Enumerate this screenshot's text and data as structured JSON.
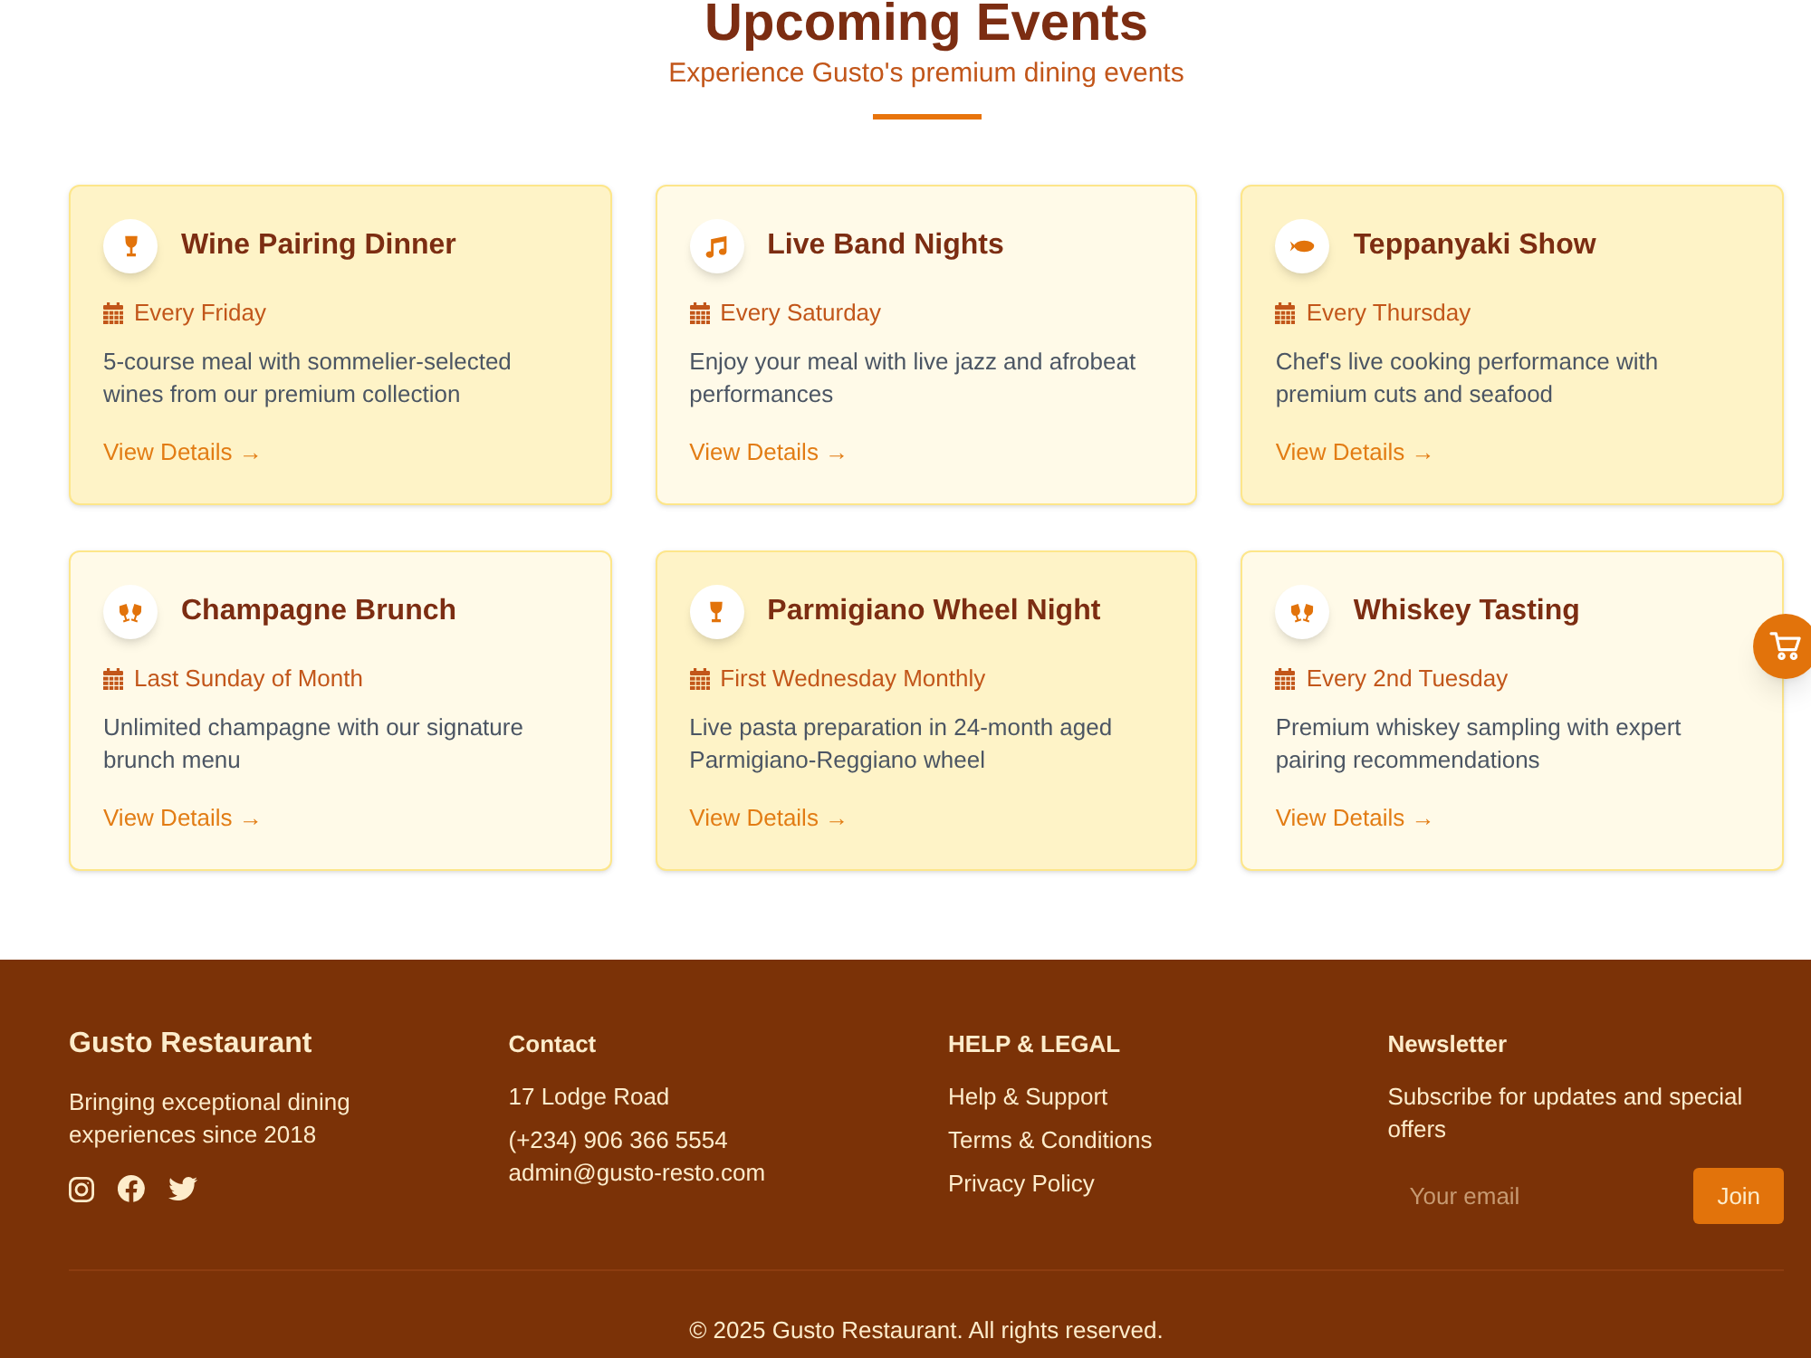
{
  "header": {
    "title": "Upcoming Events",
    "subtitle": "Experience Gusto's premium dining events"
  },
  "events": [
    {
      "kind": "wine",
      "title": "Wine Pairing Dinner",
      "schedule": "Every Friday",
      "description": "5-course meal with sommelier-selected wines from our premium collection",
      "link": "View Details →"
    },
    {
      "kind": "music",
      "title": "Live Band Nights",
      "schedule": "Every Saturday",
      "description": "Enjoy your meal with live jazz and afrobeat performances",
      "link": "View Details →"
    },
    {
      "kind": "fish",
      "title": "Teppanyaki Show",
      "schedule": "Every Thursday",
      "description": "Chef's live cooking performance with premium cuts and seafood",
      "link": "View Details →"
    },
    {
      "kind": "toast",
      "title": "Champagne Brunch",
      "schedule": "Last Sunday of Month",
      "description": "Unlimited champagne with our signature brunch menu",
      "link": "View Details →"
    },
    {
      "kind": "wine",
      "title": "Parmigiano Wheel Night",
      "schedule": "First Wednesday Monthly",
      "description": "Live pasta preparation in 24-month aged Parmigiano-Reggiano wheel",
      "link": "View Details →"
    },
    {
      "kind": "toast",
      "title": "Whiskey Tasting",
      "schedule": "Every 2nd Tuesday",
      "description": "Premium whiskey sampling with expert pairing recommendations",
      "link": "View Details →"
    }
  ],
  "footer": {
    "brand": {
      "name": "Gusto Restaurant",
      "tagline": "Bringing exceptional dining experiences since 2018",
      "social": [
        {
          "kind": "instagram"
        },
        {
          "kind": "facebook"
        },
        {
          "kind": "twitter"
        }
      ]
    },
    "contact": {
      "heading": "Contact",
      "address": "17 Lodge Road",
      "phone": "(+234) 906 366 5554",
      "email": "admin@gusto-resto.com"
    },
    "help": {
      "heading": "HELP & LEGAL",
      "links": [
        "Help & Support",
        "Terms & Conditions",
        "Privacy Policy"
      ]
    },
    "newsletter": {
      "heading": "Newsletter",
      "text": "Subscribe for updates and special offers",
      "placeholder": "Your email",
      "button": "Join"
    },
    "copyright": "© 2025 Gusto Restaurant. All rights reserved."
  }
}
